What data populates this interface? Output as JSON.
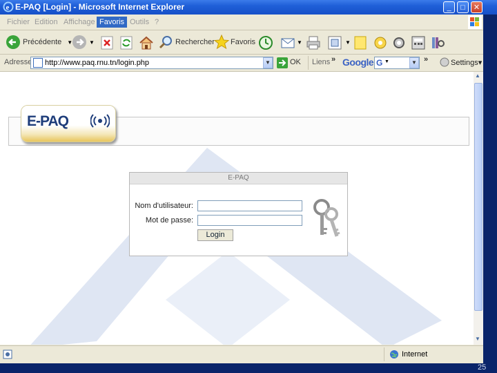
{
  "window": {
    "title": "E-PAQ [Login] - Microsoft Internet Explorer",
    "controls": [
      "_",
      "□",
      "✕"
    ]
  },
  "menu": [
    "Fichier",
    "Edition",
    "Affichage",
    "Favoris",
    "Outils",
    "?"
  ],
  "menu_active": "Favoris",
  "toolbar": {
    "back_label": "Précédente",
    "search_label": "Rechercher",
    "favorites_label": "Favoris"
  },
  "address": {
    "label": "Adresse",
    "url": "http://www.paq.rnu.tn/login.php",
    "go_label": "OK",
    "links_label": "Liens",
    "google_label": "Google",
    "settings_label": "Settings"
  },
  "page": {
    "logo_text": "E-PAQ",
    "login": {
      "heading": "E-PAQ",
      "username_label": "Nom d'utilisateur:",
      "password_label": "Mot de passe:",
      "username_value": "",
      "password_value": "",
      "button_label": "Login"
    }
  },
  "status": {
    "zone": "Internet",
    "slide_number": "25"
  },
  "colors": {
    "titlebar": "#1f5fd8",
    "watermark": "#dfe6f3",
    "logo_blue": "#1e3d7a",
    "logo_gold": "#e8c55b"
  }
}
